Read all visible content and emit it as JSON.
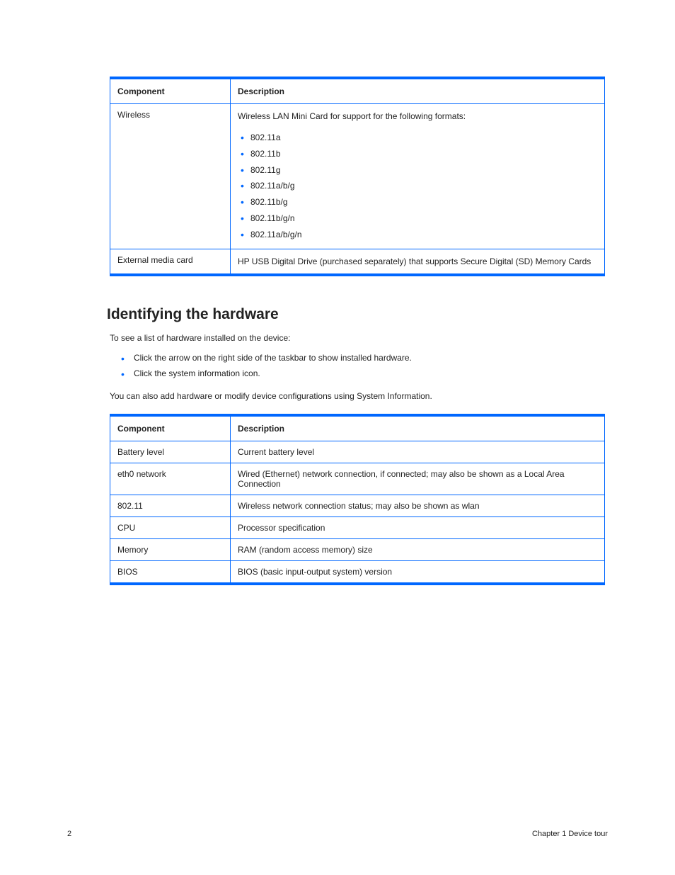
{
  "table1": {
    "headers": [
      "Component",
      "Description"
    ],
    "rows": [
      {
        "label": "Wireless",
        "lead": "Wireless LAN Mini Card for support for the following formats:",
        "items": [
          "802.11a",
          "802.11b",
          "802.11g",
          "802.11a/b/g",
          "802.11b/g",
          "802.11b/g/n",
          "802.11a/b/g/n"
        ]
      },
      {
        "label": "External media card",
        "desc": "HP USB Digital Drive (purchased separately) that supports Secure Digital (SD) Memory Cards"
      }
    ]
  },
  "section_title": "Identifying the hardware",
  "intro": "To see a list of hardware installed on the device:",
  "checks": [
    "Click the arrow on the right side of the taskbar to show installed hardware.",
    "Click the system information icon."
  ],
  "post": "You can also add hardware or modify device configurations using System Information.",
  "table2": {
    "headers": [
      "Component",
      "Description"
    ],
    "rows": [
      {
        "c1": "Battery level",
        "c2": "Current battery level"
      },
      {
        "c1": "eth0 network",
        "c2": "Wired (Ethernet) network connection, if connected; may also be shown as a Local Area Connection"
      },
      {
        "c1": "802.11",
        "c2": "Wireless network connection status; may also be shown as wlan"
      },
      {
        "c1": "CPU",
        "c2": "Processor specification"
      },
      {
        "c1": "Memory",
        "c2": "RAM (random access memory) size"
      },
      {
        "c1": "BIOS",
        "c2": "BIOS (basic input-output system) version"
      }
    ]
  },
  "footer": {
    "page": "2",
    "chapter": "Chapter 1   Device tour"
  }
}
